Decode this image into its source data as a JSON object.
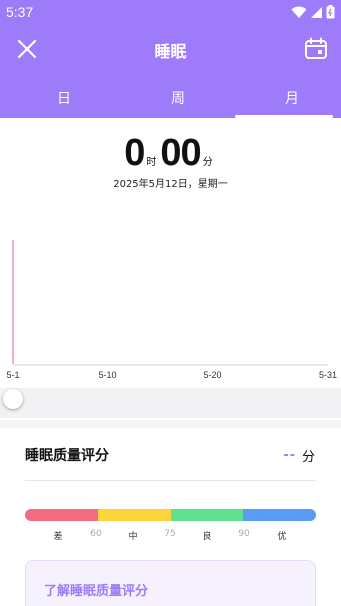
{
  "status_bar": {
    "time": "5:37",
    "icons": [
      "wifi-icon",
      "signal-icon",
      "battery-icon"
    ]
  },
  "header": {
    "title": "睡眠",
    "close_icon": "close-icon",
    "calendar_icon": "calendar-icon",
    "background": "#9e7cf9"
  },
  "tabs": [
    {
      "label": "日",
      "selected": false
    },
    {
      "label": "周",
      "selected": false
    },
    {
      "label": "月",
      "selected": true
    }
  ],
  "summary": {
    "hours": "0",
    "hours_unit": "时",
    "minutes": "00",
    "minutes_unit": "分",
    "date": "2025年5月12日，星期一"
  },
  "chart_data": {
    "type": "bar",
    "title": "",
    "xlabel": "",
    "ylabel": "",
    "x_tick_labels": [
      "5-1",
      "5-10",
      "5-20",
      "5-31"
    ],
    "series": [
      {
        "values": []
      }
    ],
    "grid": false,
    "highlight_color": "#e8657a"
  },
  "quality": {
    "title": "睡眠质量评分",
    "score": "--",
    "score_unit": "分",
    "levels": [
      {
        "label": "差",
        "color": "#f36b7f"
      },
      {
        "label": "中",
        "color": "#fbd53a"
      },
      {
        "label": "良",
        "color": "#5fe18d"
      },
      {
        "label": "优",
        "color": "#5a9cf5"
      }
    ],
    "thresholds": [
      "60",
      "75",
      "90"
    ]
  },
  "learn_more": {
    "label": "了解睡眠质量评分"
  }
}
